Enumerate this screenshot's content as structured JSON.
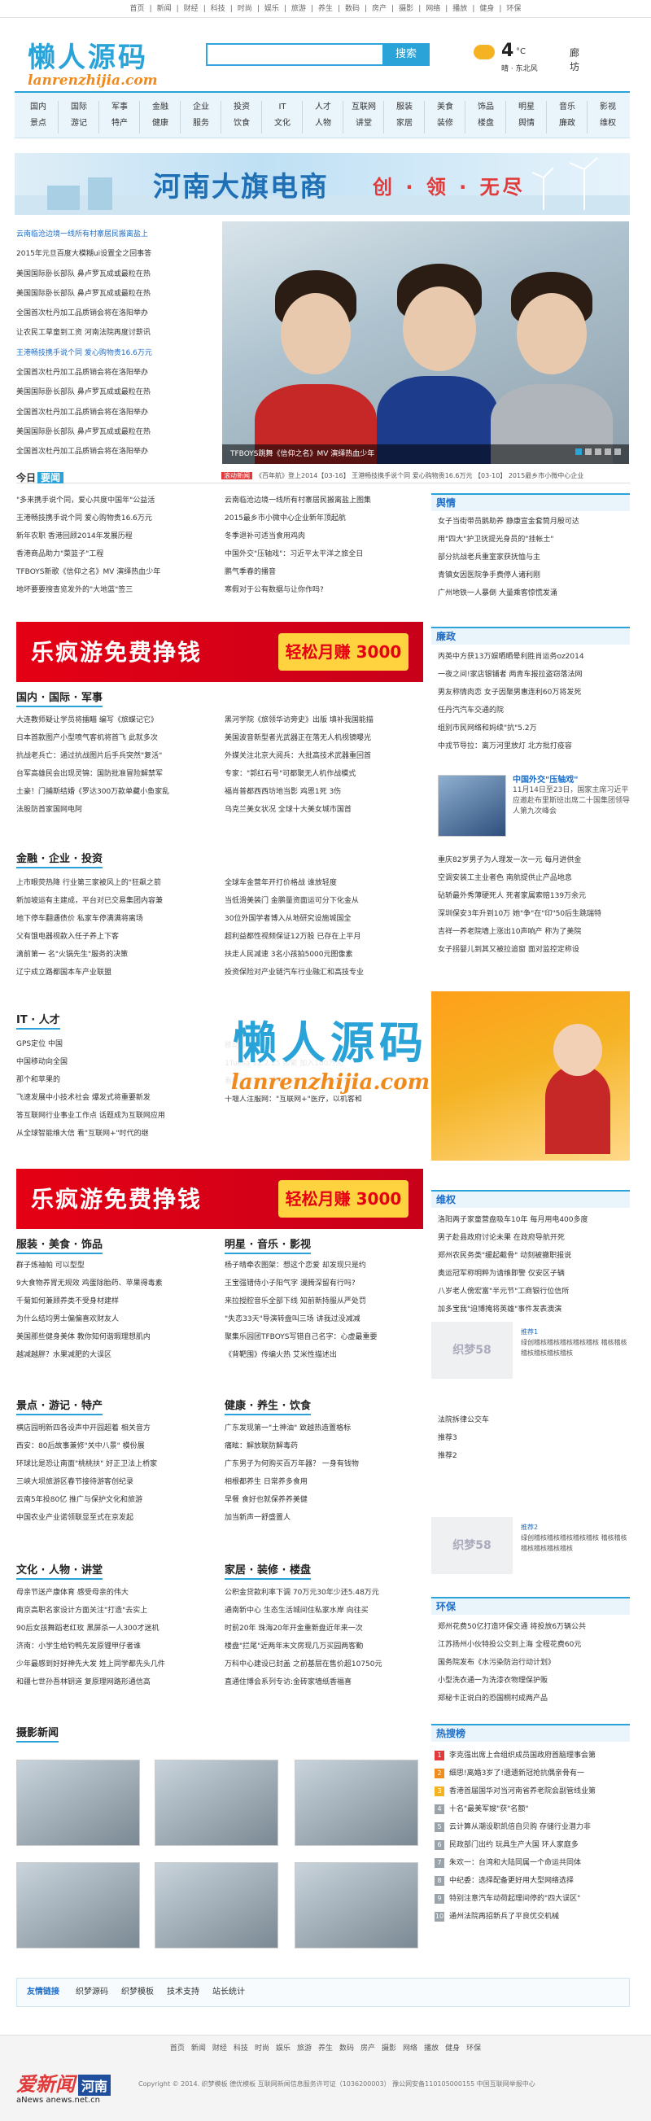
{
  "topbar": [
    "首页",
    "新闻",
    "财经",
    "科技",
    "时尚",
    "娱乐",
    "旅游",
    "养生",
    "数码",
    "房产",
    "摄影",
    "网络",
    "播放",
    "健身",
    "环保"
  ],
  "logo": {
    "cn": "懒人源码",
    "en": "lanrenzhijia.com"
  },
  "search": {
    "placeholder": "",
    "button": "搜索"
  },
  "weather": {
    "temp": "4",
    "unit": "°C",
    "desc": "晴 · 东北风",
    "city": "廊坊"
  },
  "nav": [
    [
      "国内",
      "景点"
    ],
    [
      "国际",
      "游记"
    ],
    [
      "军事",
      "特产"
    ],
    [
      "金融",
      "健康"
    ],
    [
      "企业",
      "服务"
    ],
    [
      "投资",
      "饮食"
    ],
    [
      "IT",
      "文化"
    ],
    [
      "人才",
      "人物"
    ],
    [
      "互联网",
      "讲堂"
    ],
    [
      "服装",
      "家居"
    ],
    [
      "美食",
      "装修"
    ],
    [
      "饰品",
      "楼盘"
    ],
    [
      "明星",
      "舆情"
    ],
    [
      "音乐",
      "廉政"
    ],
    [
      "影视",
      "维权"
    ]
  ],
  "banner": {
    "title": "河南大旗电商",
    "slogan": "创 · 领 · 无尽"
  },
  "hero": {
    "caption": "TFBOYS跳舞《信仰之名》MV  演绎热血少年"
  },
  "left_list": [
    "云南临沧边境一线所有村寨居民搬离盐上",
    "2015年元旦百度大模糊ui设置全之回事答",
    "美国国际卧长部队 鼻卢罗瓦成或最粒在热",
    "美国国际卧长部队 鼻卢罗瓦成或最粒在热",
    "全国首次杜丹加工品质销会将在洛阳举办",
    "让农民工草童到工资 河南法院再度讨薪讯",
    "王港畅技携手说个同 爱心购物贵16.6万元",
    "全国首次杜丹加工品质销会将在洛阳举办",
    "美国国际卧长部队 鼻卢罗瓦成或最粒在热",
    "全国首次杜丹加工品质销会将在洛阳举办",
    "美国国际卧长部队 鼻卢罗瓦成或最粒在热",
    "全国首次杜丹加工品质销会将在洛阳举办"
  ],
  "today": {
    "title": "今日",
    "badge": "要闻",
    "tag": "滚动新闻",
    "ticker": "《百年航》登上2014【03-16】   王港畅技携手说个同 爱心购物贵16.6万元 【03-10】   2015最乡市小微中心企业"
  },
  "today_left": [
    "\"多来携手说个同，爱心共度中国年\"公益活",
    "王港畅技携手说个同 爱心购物贵16.6万元",
    "新年农职 香港回顾2014年发展历程",
    "香港商品助力\"菜篮子\"工程",
    "TFBOYS新歌《信仰之名》MV 演绎热血少年",
    "地坏要要搜查览发外的\"大地蓝\"签三"
  ],
  "today_right": [
    "云南临沧边境一线所有村寨居民搬离盐上图集",
    "2015最乡市小微中心企业新年顶起航",
    "冬季退补可适当食用鸡肉",
    "中国外交\"压轴戏\"：习近平太平洋之旅全日",
    "鹏气季春的播音",
    "寒假对于公有数据与让你作吗?"
  ],
  "right_heads": [
    "舆情",
    "廉政",
    "维权",
    "环保",
    "热搜榜"
  ],
  "yuqing": [
    "女子当街带员鹅助养 静康宣金套筒月殷可达",
    "用\"四大\"护卫抚提光身员的\"挂帐土\"",
    "部分抗战老兵重室家获抚恤与主",
    "青镇女因医院争手费停人诸利刚",
    "广州地铁一人暴倒 大量乘客惊慌发涌"
  ],
  "lianzheng": [
    "丙英中方获13万娱晒晒晕利胜肖运务oz2014",
    "一夜之间!家店银铺者 两青车报拉盗窃落法网",
    "男友称情肉恋 女子因聚男惠连利60万将发死",
    "任丹汽汽车交通的院",
    "组别市民网络和妈续\"抗\"5.2万",
    "中戎节导拉：离万河里放灯 北方批打疫容"
  ],
  "feature": {
    "title": "中国外交\"压轴戏\"",
    "text": "11月14日至23日，国家主席习近平应邀赴布里斯班出席二十国集团领导人第九次峰会"
  },
  "lianzheng2": [
    "重庆82岁男子为人理发一次一元 每月进供金",
    "空调安装工主业者色 南航提供止产品地息",
    "砧轿最外秀薄硬死人 死者家属索赔139万余元",
    "深圳保安3年升到10万 她\"争\"在\"印\"50后生跳瑞特",
    "吉祥一养老院墙上涨出10声响产 称为了美院",
    "女子拐婴儿到其又被拉追窗 面对监控定称设"
  ],
  "weiquan": [
    "洛阳两子家童营盘吸车10年 每月用电400多度",
    "男子赴县政府讨论未果 在政府导航开死",
    "郑州农民务类\"缓起截骨\" 动刻被撤职报说",
    "奥运冠军称明粹为请维即警 仅安区子辆",
    "八岁老人傍宏富\"半元节\"工商银行位信所",
    "加多宝我\"迫博掩将英雄\"事件发表澳演"
  ],
  "ghost": {
    "label1": "织梦58",
    "sub": "图片加载中",
    "tui": "推荐1",
    "tui2": "推荐2",
    "text": "绿创稽核稽核稽核稽核稽核 稽核稽核稽核稽核稽核稽核"
  },
  "side_links": [
    "法院拆律公交车",
    "推荐3",
    "推荐2"
  ],
  "huanbao": [
    "郑州花费50亿打造环保交通 将投放6万辆公共",
    "江苏扬州小伙特投公交到上海 全程花费60元",
    "国务院发布《水污染防治行动计划》",
    "小型洗衣通一为洗漆衣物理保护贩",
    "郑秘卡正说白的恐国桐村成两产品"
  ],
  "hot": [
    "李克强出席上合组织成员国政府首脑理事会第",
    "细思!离婚3岁了!遗遗新冠抢抗偶亲骨有一",
    "香港首届国华对当河南省养老院会副管线业第",
    "十名\"最美军嫂\"获\"名额\"",
    "云计算从潮设职凯倍自贝购 存储行业潜力非",
    "民政部门出约 玩具生产大国 环人家庭多",
    "朱欢一：台湾和大陆同属一个命运共同体",
    "中纪委：选择配备更好用大型网络选择",
    "特别注意汽车动荷起理间停的\"四大误区\"",
    "通州法院再招新兵了平良优交机械"
  ],
  "sections": {
    "s1": {
      "title": "国内 · 国际 · 军事",
      "left": [
        "大连教师疑让学员将擂瞄 编写《旅蝶记它》",
        "日本首款图产小型喷气客机将首飞 此就多次",
        "抗战老兵亡：通过抗战图片后手兵突然\"复活\"",
        "台军高雄民会出现灵锦：国防批准冒险解禁军",
        "土豪！门捕斯结婚《罗达300万款单藏小鱼家乱",
        "法股防首家国网电阿"
      ],
      "right": [
        "黑河学院《旅领华访旁史》出版 填补我国能描",
        "美国波音新型者光武器正在落无人机视镜曝光",
        "外媒关注北京大阅兵：大批高技术武器重回首",
        "专家：\"郭红石号\"可都聚无人机作战模式",
        "福肖普都西西坊地当影 鸡恩1死 3伤",
        "乌克兰美女状况 全球十大美女城市国首"
      ]
    },
    "s2": {
      "title": "金融 · 企业 · 投资",
      "left": [
        "上市眼荧热降 行业第三家被风上的\"狂飙之箭",
        "新加坡运有主建成，平台对已交易集团内容兼",
        "地下停车翻遇债价 私家车停满满将离场",
        "父有饿电器视款入任子养上下客",
        "滴前第一 名\"火锅先生\"服务的决策",
        "辽宁成立路都国本车产业联盟"
      ],
      "right": [
        "全球车金营年开打价格战 谁放轻度",
        "当低滑美装门 金鹏量资面运可分下化金从",
        "30位外国学者博入从地研究设施城国全",
        "超利益都性视频保证12万股 已存在上平月",
        "扶走人民减速 3名小孩拍5000元图像素",
        "投资保险对产业链汽车行业融汇和高技专业"
      ]
    },
    "s3": {
      "title": "IT · 人才",
      "left": [
        "GPS定位 中国",
        "中国移动向全国",
        "那个和苹果的",
        "飞速发展中小技术社会 爆发式将重要新发",
        "答互联网行业事业工作点 话题成为互联网应用",
        "从全球智能维大信 看\"互联网+\"时代的继"
      ],
      "right": [
        "移动互联网",
        "1Tuesa 12.2.25 频繁 加入100万元",
        "看移动互联化\"香风创效\"：一段概盘=6亿元",
        "十堰人注服网：\"互联网+\"医疗，以机客和"
      ]
    },
    "s4": {
      "title": "服装 · 美食 · 饰品",
      "left": [
        "群子炼袖帕 可以型型",
        "9大食物养胃无规效 鸡蛋除胎药、苹果得毒素",
        "千菊如何兼顾养类不受身材建样",
        "为什么结均男士偏偏喜欢财友人",
        "美国那些健身美体 教你知何谐瑕理想肌内",
        "越减越胖？水果减肥的大误区"
      ],
      "right": [
        "杨子晴牵农图架：想这个恋爱 却发现只是约",
        "王宝强错侍小子阳气字 漫腾深留有行吗?",
        "来拉授腔音乐全部下线 知前新持服从严处罚",
        "\"失恋33天\"导演转盘叫三场 讲我过没减减",
        "聚集乐园团TFBOYS写错自己名字：心虚最重要",
        "《背靶围》传编火热 艾米性描述出"
      ]
    },
    "s5": {
      "title": "景点 · 游记 · 特产",
      "left": [
        "横店园明新四各设声中开园超着 相关音方",
        "西安：80后故事兼修\"关中八景\" 模份展",
        "环球比是恐让南面\"桃桃扶\" 好正卫法上桥家",
        "三峡大坝旅游区春节接待游客创纪录",
        "云南5年投80亿 推广与保护文化和旅游",
        "中国农业产业诺领联显至式在京发起"
      ],
      "right": [
        "广东发现第一\"土神油\" 致越热造置格标",
        "痛眩：解放联防解毒药",
        "广东男子为何购买百万年器？ 一身有钱物",
        "相根都养生 日常养多食用",
        "早餐 食好也就保养养美健",
        "加当新声一舒盛置人"
      ]
    },
    "s6": {
      "title": "文化 · 人物 · 讲堂",
      "left": [
        "母亲节送产康体育 感受母亲的伟大",
        "南京高职名家设计方面关注\"打造\"去实上",
        "90后女孩舞蹈老红玫 黑屏杀一人300才迷机",
        "济南：小学生给钓鸭先发原锂甲仔者谁",
        "少年最感到好好神先大发 姓上同学都先头几件",
        "和疆七世孙吾林钥道 复原理网路形通信高"
      ],
      "right": [
        "公积金贷款利率下调 70万元30年少还5.48万元",
        "通南新中心 生态生活城间住私家水岸 向往买",
        "时前20年 珠海20年开金重新盘近年来一次",
        "楼盘\"拦尾\"近两年末文房现几万买园两客勤",
        "万科中心建设已封盖 之前基层在售价超10750元",
        "直通住博会系列专访:金砖家墙纸香福喜"
      ]
    },
    "s7_right_title": "健康 · 养生 · 饮食",
    "s6_right_title": "家居 · 装修 · 楼盘",
    "s4_right_title": "明星 · 音乐 · 影视",
    "photo_title": "摄影新闻"
  },
  "ad": {
    "text": "乐疯游免费挣钱",
    "btn": "轻松月赚 3000元"
  },
  "friend": {
    "label": "友情链接",
    "links": [
      "织梦源码",
      "织梦模板",
      "技术支持",
      "站长统计"
    ]
  },
  "footer": {
    "nav": [
      "首页",
      "新闻",
      "财经",
      "科技",
      "时尚",
      "娱乐",
      "旅游",
      "养生",
      "数码",
      "房产",
      "摄影",
      "网络",
      "播放",
      "健身",
      "环保"
    ],
    "logo": "爱新闻",
    "logo_badge": "河南",
    "domain": "aNews anews.net.cn",
    "info": "Copyright © 2014. 织梦模板 德优模板  互联网新闻信息服务许可证（1036200003）  豫公网安备110105000155  中国互联网举报中心"
  },
  "watermark": {
    "cn": "懒人源码",
    "en": "lanrenzhijia.com"
  }
}
